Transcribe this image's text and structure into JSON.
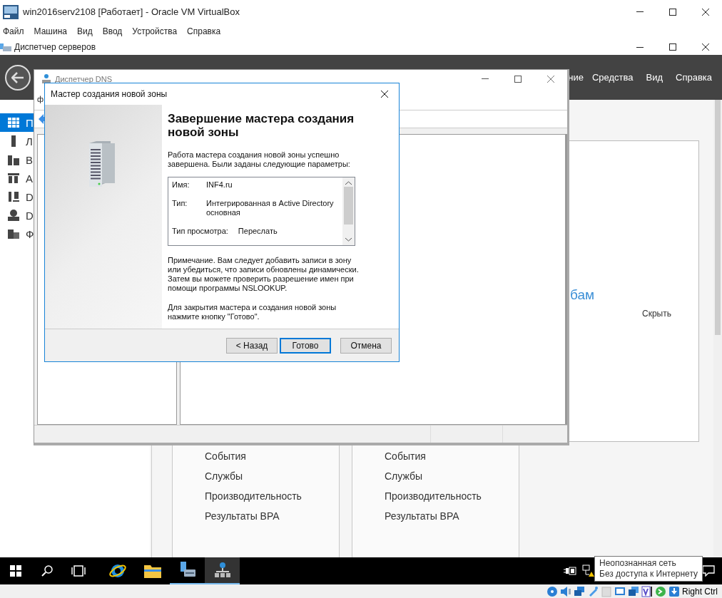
{
  "vbox": {
    "title": "win2016serv2108 [Работает] - Oracle VM VirtualBox",
    "menu": [
      "Файл",
      "Машина",
      "Вид",
      "Ввод",
      "Устройства",
      "Справка"
    ],
    "host_key": "Right Ctrl"
  },
  "server_manager": {
    "title": "Диспетчер серверов",
    "header_menu": [
      "ние",
      "Средства",
      "Вид",
      "Справка"
    ],
    "sidebar": [
      {
        "label": "П",
        "selected": true
      },
      {
        "label": "Л",
        "selected": false
      },
      {
        "label": "В",
        "selected": false
      },
      {
        "label": "A",
        "selected": false
      },
      {
        "label": "D",
        "selected": false
      },
      {
        "label": "D",
        "selected": false
      },
      {
        "label": "Ф",
        "selected": false
      }
    ],
    "welcome": {
      "link": "бам",
      "hide": "Скрыть"
    },
    "tiles": [
      {
        "items": [
          "События",
          "Службы",
          "Производительность",
          "Результаты BPA"
        ]
      },
      {
        "items": [
          "События",
          "Службы",
          "Производительность",
          "Результаты BPA"
        ]
      }
    ]
  },
  "dns_window": {
    "title": "Диспетчер DNS",
    "menu": [
      "ф"
    ]
  },
  "wizard": {
    "title": "Мастер создания новой зоны",
    "heading": "Завершение мастера создания новой зоны",
    "intro": "Работа мастера создания новой зоны успешно завершена. Были заданы следующие параметры:",
    "summary": [
      {
        "label": "Имя:",
        "value": "INF4.ru"
      },
      {
        "label": "Тип:",
        "value": "Интегрированная в Active Directory основная"
      },
      {
        "label": "Тип просмотра:",
        "value": "Переслать"
      }
    ],
    "note": "Примечание. Вам следует добавить записи в зону или убедиться, что записи обновлены динамически. Затем вы можете проверить разрешение имен при помощи программы NSLOOKUP.",
    "closing": "Для закрытия мастера и создания новой зоны нажмите кнопку \"Готово\".",
    "buttons": [
      {
        "label": "< Назад",
        "default": false
      },
      {
        "label": "Готово",
        "default": true
      },
      {
        "label": "Отмена",
        "default": false
      }
    ]
  },
  "taskbar": {
    "apps": [
      {
        "kind": "browser",
        "running": false,
        "selected": false
      },
      {
        "kind": "explorer",
        "running": false,
        "selected": false
      },
      {
        "kind": "server-manager",
        "running": true,
        "selected": false
      },
      {
        "kind": "dns",
        "running": true,
        "selected": true
      }
    ]
  },
  "tooltip": {
    "lines": [
      "Неопознанная сеть",
      "Без доступа к Интернету"
    ]
  }
}
